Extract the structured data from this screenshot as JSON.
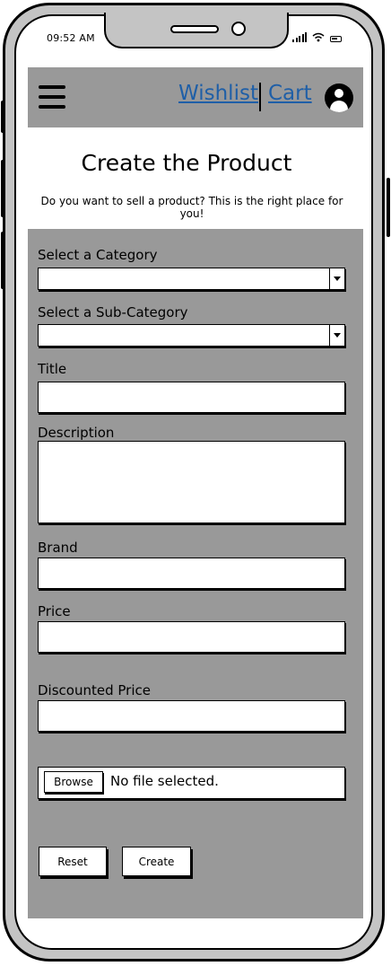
{
  "status_bar": {
    "time": "09:52 AM"
  },
  "header": {
    "wishlist_label": "Wishlist",
    "cart_label": "Cart"
  },
  "page": {
    "title": "Create the Product",
    "subtitle": "Do you want to sell a product? This is the right place for you!"
  },
  "form": {
    "category_label": "Select a Category",
    "subcategory_label": "Select a Sub-Category",
    "title_label": "Title",
    "description_label": "Description",
    "brand_label": "Brand",
    "price_label": "Price",
    "discounted_price_label": "Discounted Price",
    "browse_label": "Browse",
    "file_status": "No file selected.",
    "reset_label": "Reset",
    "create_label": "Create"
  },
  "colors": {
    "header_bg": "#999999",
    "form_bg": "#999999",
    "link": "#1f5fa7",
    "frame": "#c4c4c4"
  },
  "icons": [
    "hamburger-menu-icon",
    "user-avatar-icon",
    "signal-icon",
    "wifi-icon",
    "battery-icon"
  ]
}
